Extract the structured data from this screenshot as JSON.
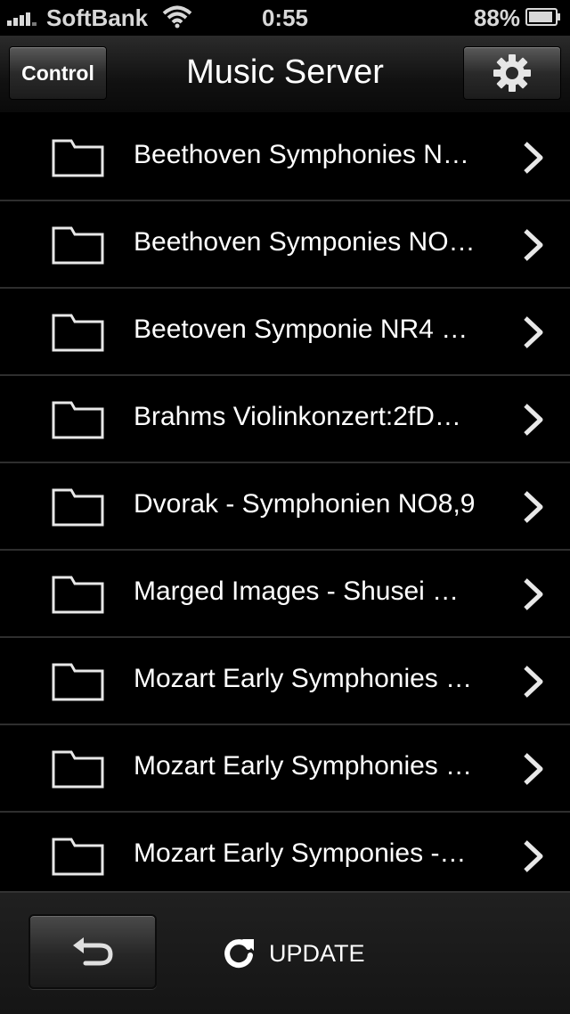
{
  "status_bar": {
    "carrier": "SoftBank",
    "time": "0:55",
    "battery": "88%"
  },
  "nav": {
    "title": "Music Server",
    "control_label": "Control",
    "settings_icon": "gear-icon"
  },
  "folders": [
    {
      "label": "Beethoven Symphonies N…"
    },
    {
      "label": "Beethoven Symponies NO…"
    },
    {
      "label": "Beetoven Symponie NR4 …"
    },
    {
      "label": "Brahms Violinkonzert:2fD…"
    },
    {
      "label": "Dvorak - Symphonien NO8,9"
    },
    {
      "label": "Marged Images - Shusei …"
    },
    {
      "label": "Mozart Early Symphonies …"
    },
    {
      "label": "Mozart Early Symphonies …"
    },
    {
      "label": "Mozart Early Symponies -…"
    }
  ],
  "toolbar": {
    "back_icon": "return-arrow-icon",
    "update_label": "UPDATE",
    "update_icon": "refresh-icon"
  },
  "colors": {
    "background": "#000000",
    "separator": "#2e2e2e",
    "text": "#ffffff"
  }
}
